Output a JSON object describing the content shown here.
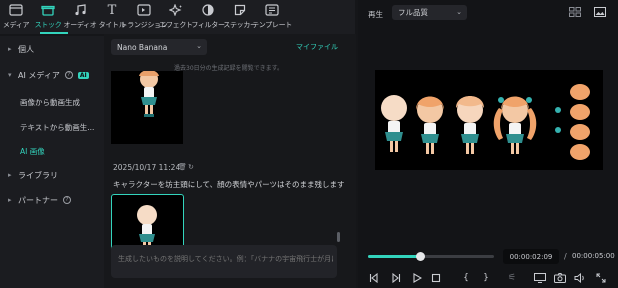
{
  "toolbar": {
    "tabs": [
      {
        "label": "メディア",
        "icon": "media-icon"
      },
      {
        "label": "ストック",
        "icon": "stock-icon"
      },
      {
        "label": "オーディオ",
        "icon": "music-note-icon"
      },
      {
        "label": "タイトル",
        "icon": "title-t-icon"
      },
      {
        "label": "トランジション",
        "icon": "transition-icon"
      },
      {
        "label": "エフェクト",
        "icon": "effect-sparkle-icon"
      },
      {
        "label": "フィルター",
        "icon": "filter-icon"
      },
      {
        "label": "ステッカー",
        "icon": "sticker-icon"
      },
      {
        "label": "テンプレート",
        "icon": "template-icon"
      }
    ],
    "active_tab": "ストック",
    "accent": "#33d4bd"
  },
  "sidebar": {
    "personal": "個人",
    "ai_media": "AI メディア",
    "ai_badge": "AI",
    "sub_items": [
      "画像から動画生成",
      "テキストから動画生...",
      "AI 画像"
    ],
    "active_sub": "AI 画像",
    "library": "ライブラリ",
    "partner": "パートナー"
  },
  "middle": {
    "model": "Nano Banana",
    "my_files": "マイファイル",
    "history_hint": "過去30日分の生成記録を閲覧できます。",
    "timestamp": "2025/10/17 11:24",
    "prompt": "キャラクターを坊主頭にして、顔の表情やパーツはそのまま残します",
    "input_placeholder": "生成したいものを説明してください。例：「バナナの宇宙飛行士が月に"
  },
  "player": {
    "label": "再生",
    "quality": "フル品質",
    "current_time": "00:00:02:09",
    "separator": "/",
    "total_time": "00:00:05:00",
    "progress": 0.42
  }
}
